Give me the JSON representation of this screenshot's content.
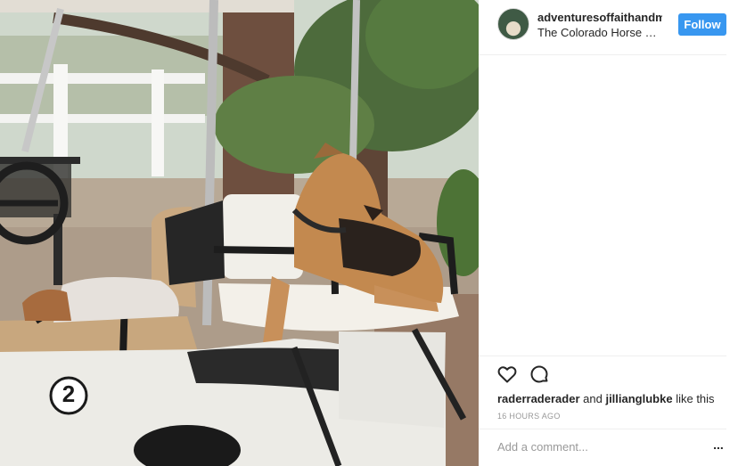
{
  "post": {
    "username": "adventuresoffaithandme",
    "location": "The Colorado Horse Rescue",
    "follow_label": "Follow",
    "golf_cart_number": "2",
    "likes": {
      "user1": "raderraderader",
      "joiner": "and",
      "user2": "jillianglubke",
      "suffix": "like this"
    },
    "timestamp": "16 HOURS AGO",
    "comment_placeholder": "Add a comment...",
    "more_label": "..."
  },
  "icons": {
    "like": "heart-icon",
    "comment": "speech-bubble-icon",
    "more": "more-options-icon"
  },
  "colors": {
    "follow_button": "#3897f0",
    "text": "#262626",
    "muted": "#999999",
    "divider": "#efefef"
  }
}
